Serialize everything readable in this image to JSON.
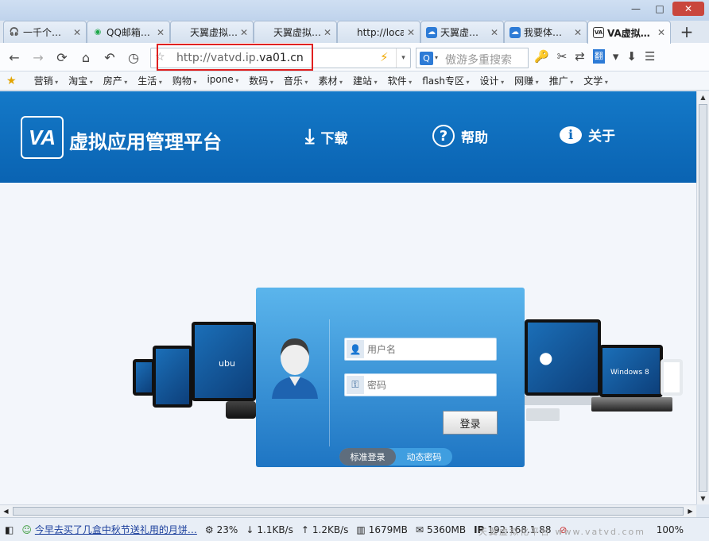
{
  "window": {
    "min": "—",
    "max": "□",
    "close": "✕"
  },
  "tabs": [
    {
      "icon": "headphones-icon",
      "glyph": "🎧",
      "label": "一千个…",
      "active": false
    },
    {
      "icon": "qq-mail-icon",
      "glyph": "◉",
      "label": "QQ邮箱…",
      "active": false
    },
    {
      "icon": "blank-icon",
      "glyph": "",
      "label": "天翼虚拟…",
      "active": false
    },
    {
      "icon": "blank-icon",
      "glyph": "",
      "label": "天翼虚拟…",
      "active": false
    },
    {
      "icon": "blank-icon",
      "glyph": "",
      "label": "http://local…",
      "active": false
    },
    {
      "icon": "cloud-icon",
      "glyph": "☁",
      "label": "天翼虚…",
      "active": false
    },
    {
      "icon": "cloud-icon",
      "glyph": "☁",
      "label": "我要体…",
      "active": false
    },
    {
      "icon": "va-icon",
      "glyph": "VA",
      "label": "VA虚拟…",
      "active": true
    }
  ],
  "tab_close": "✕",
  "new_tab": "+",
  "nav": {
    "back": "←",
    "forward": "→",
    "refresh": "⟳",
    "home": "⌂",
    "undo": "↶",
    "history": "◷",
    "url_prefix": "http://vatvd.ip.",
    "url_domain": "va01.cn",
    "url_star": "☆",
    "url_bolt": "⚡",
    "url_dropdown": "▾",
    "search_engine": "Q",
    "search_placeholder": "傲游多重搜索",
    "tools": [
      "🔑",
      "✂",
      "⇄",
      "翻",
      "▾",
      "⬇",
      "☰"
    ]
  },
  "bookmarks": [
    "营销",
    "淘宝",
    "房产",
    "生活",
    "购物",
    "ipone",
    "数码",
    "音乐",
    "素材",
    "建站",
    "软件",
    "flash专区",
    "设计",
    "网赚",
    "推广",
    "文学"
  ],
  "bookmark_star": "★",
  "header": {
    "logo": "VA",
    "title": "虚拟应用管理平台",
    "nav": [
      {
        "icon": "download-icon",
        "glyph": "⤓",
        "label": "下载"
      },
      {
        "icon": "help-icon",
        "glyph": "?",
        "label": "帮助"
      },
      {
        "icon": "info-icon",
        "glyph": "ℹ",
        "label": "关于"
      }
    ]
  },
  "login": {
    "username_placeholder": "用户名",
    "password_placeholder": "密码",
    "submit": "登录",
    "mode_standard": "标准登录",
    "mode_dynamic": "动态密码"
  },
  "devices": {
    "ubuntu": "ubu",
    "windows": "Windows 8"
  },
  "status": {
    "news": "今早去买了几盒中秋节送礼用的月饼…",
    "cpu": "23%",
    "down": "1.1KB/s",
    "up": "1.2KB/s",
    "mem1": "1679MB",
    "mem2": "5360MB",
    "ip_label": "IP",
    "ip": "192.168.1.88",
    "zoom": "100%",
    "watermark": "天翼虚拟化平台 www.vatvd.com"
  }
}
